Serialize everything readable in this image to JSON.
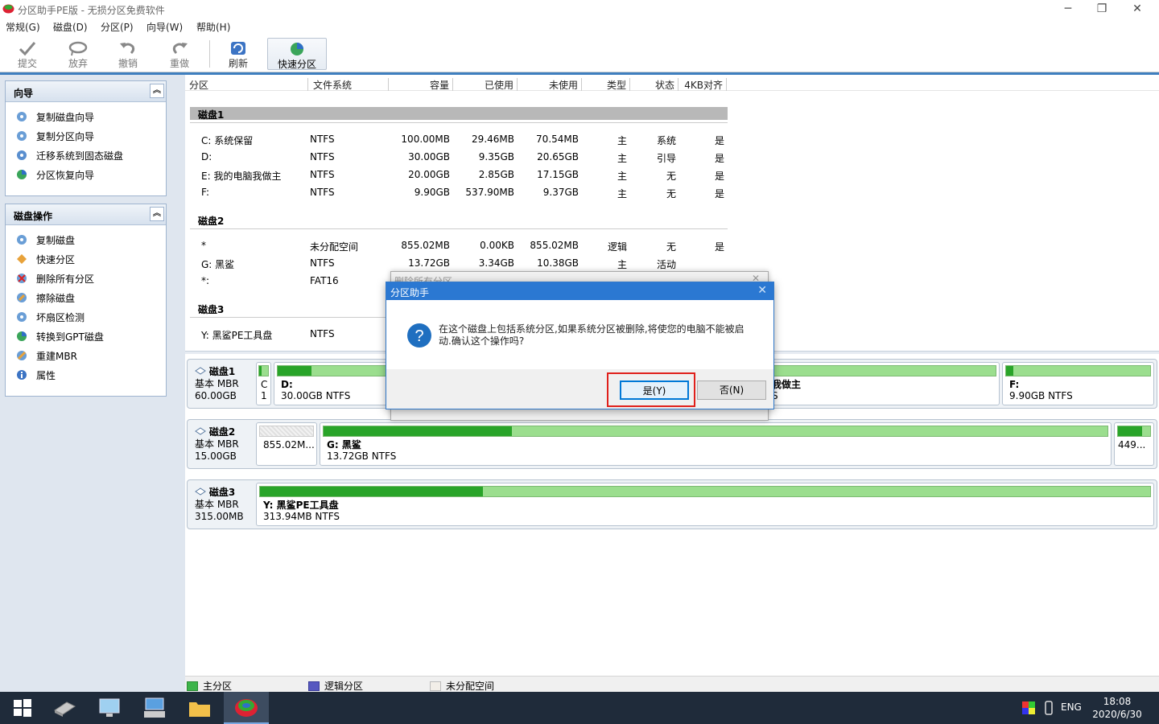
{
  "window": {
    "title": "分区助手PE版 - 无损分区免费软件",
    "controls": [
      "─",
      "❐",
      "✕"
    ]
  },
  "menu": [
    "常规(G)",
    "磁盘(D)",
    "分区(P)",
    "向导(W)",
    "帮助(H)"
  ],
  "toolbar": {
    "commit": "提交",
    "discard": "放弃",
    "undo": "撤销",
    "redo": "重做",
    "refresh": "刷新",
    "quick_partition": "快速分区"
  },
  "wizard_panel": {
    "title": "向导",
    "items": [
      "复制磁盘向导",
      "复制分区向导",
      "迁移系统到固态磁盘",
      "分区恢复向导"
    ]
  },
  "disk_ops_panel": {
    "title": "磁盘操作",
    "items": [
      "复制磁盘",
      "快速分区",
      "删除所有分区",
      "擦除磁盘",
      "坏扇区检测",
      "转换到GPT磁盘",
      "重建MBR",
      "属性"
    ]
  },
  "columns": [
    "分区",
    "文件系统",
    "容量",
    "已使用",
    "未使用",
    "类型",
    "状态",
    "4KB对齐"
  ],
  "disks": [
    {
      "name": "磁盘1",
      "rows": [
        [
          "C: 系统保留",
          "NTFS",
          "100.00MB",
          "29.46MB",
          "70.54MB",
          "主",
          "系统",
          "是"
        ],
        [
          "D:",
          "NTFS",
          "30.00GB",
          "9.35GB",
          "20.65GB",
          "主",
          "引导",
          "是"
        ],
        [
          "E: 我的电脑我做主",
          "NTFS",
          "20.00GB",
          "2.85GB",
          "17.15GB",
          "主",
          "无",
          "是"
        ],
        [
          "F:",
          "NTFS",
          "9.90GB",
          "537.90MB",
          "9.37GB",
          "主",
          "无",
          "是"
        ]
      ]
    },
    {
      "name": "磁盘2",
      "rows": [
        [
          "*",
          "未分配空间",
          "855.02MB",
          "0.00KB",
          "855.02MB",
          "逻辑",
          "无",
          "是"
        ],
        [
          "G: 黑鲨",
          "NTFS",
          "13.72GB",
          "3.34GB",
          "10.38GB",
          "主",
          "活动",
          ""
        ],
        [
          "*:",
          "FAT16",
          "",
          "",
          "",
          "",
          "",
          ""
        ]
      ]
    },
    {
      "name": "磁盘3",
      "rows": [
        [
          "Y: 黑鲨PE工具盘",
          "NTFS",
          "",
          "",
          "",
          "",
          "",
          ""
        ]
      ]
    }
  ],
  "disk_map": [
    {
      "name": "磁盘1",
      "kind": "基本 MBR",
      "size": "60.00GB",
      "parts": [
        {
          "n": "C",
          "s": "1"
        },
        {
          "n": "D:",
          "s": "30.00GB NTFS",
          "used": 0.31
        },
        {
          "n": "我做主",
          "s": "S",
          "used": 0.14
        },
        {
          "n": "F:",
          "s": "9.90GB NTFS",
          "used": 0.05
        }
      ]
    },
    {
      "name": "磁盘2",
      "kind": "基本 MBR",
      "size": "15.00GB",
      "parts": [
        {
          "n": "",
          "s": "855.02M..."
        },
        {
          "n": "G: 黑鲨",
          "s": "13.72GB NTFS",
          "used": 0.24
        },
        {
          "n": "",
          "s": "449...",
          "used": 0.75
        }
      ]
    },
    {
      "name": "磁盘3",
      "kind": "基本 MBR",
      "size": "315.00MB",
      "parts": [
        {
          "n": "Y: 黑鲨PE工具盘",
          "s": "313.94MB NTFS",
          "used": 0.25
        }
      ]
    }
  ],
  "legend": [
    "主分区",
    "逻辑分区",
    "未分配空间"
  ],
  "bg_dialog_title": "删除所有分区",
  "dialog": {
    "title": "分区助手",
    "message_line1": "在这个磁盘上包括系统分区,如果系统分区被删除,将使您的电脑不能被启",
    "message_line2": "动.确认这个操作吗?",
    "yes": "是(Y)",
    "no": "否(N)"
  },
  "taskbar": {
    "lang": "ENG",
    "time": "18:08",
    "date": "2020/6/30"
  },
  "colors": {
    "accent": "#2b78d2",
    "used_bar": "#29a429",
    "free_bar": "#9bde8e",
    "highlight": "#e0201b"
  }
}
